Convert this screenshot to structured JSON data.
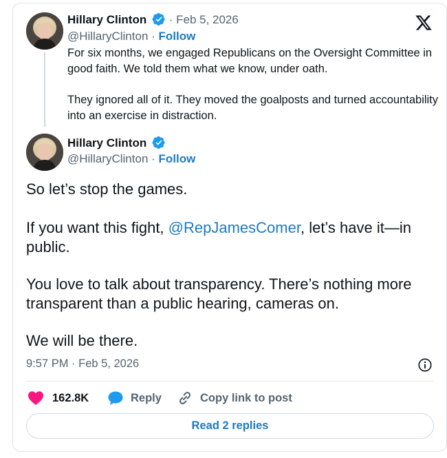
{
  "quoted_tweet": {
    "author_name": "Hillary Clinton",
    "date": "Feb 5, 2026",
    "handle": "@HillaryClinton",
    "follow_label": "Follow",
    "paragraphs": [
      "For six months, we engaged Republicans on the Oversight Committee in good faith. We told them what we know, under oath.",
      "They ignored all of it. They moved the goalposts and turned accountability into an exercise in distraction."
    ]
  },
  "main_tweet": {
    "author_name": "Hillary Clinton",
    "handle": "@HillaryClinton",
    "follow_label": "Follow",
    "p1": "So let’s stop the games.",
    "p2_before": "If you want this fight, ",
    "p2_mention": "@RepJamesComer",
    "p2_after": ", let’s have it—in public.",
    "p3": "You love to talk about transparency. There’s nothing more transparent than a public hearing, cameras on.",
    "p4": "We will be there.",
    "time": "9:57 PM",
    "date": "Feb 5, 2026"
  },
  "actions": {
    "like_count": "162.8K",
    "reply_label": "Reply",
    "copy_label": "Copy link to post"
  },
  "read_replies_label": "Read 2 replies",
  "separator": "·",
  "colors": {
    "link_blue": "#1d7ac2",
    "verified_blue": "#1d9bf0",
    "like_pink": "#f91880",
    "muted_gray": "#536471",
    "text": "#0f1419"
  },
  "icons": [
    "x-logo-icon",
    "verified-badge-icon",
    "heart-icon",
    "reply-bubble-icon",
    "link-icon",
    "info-icon"
  ]
}
